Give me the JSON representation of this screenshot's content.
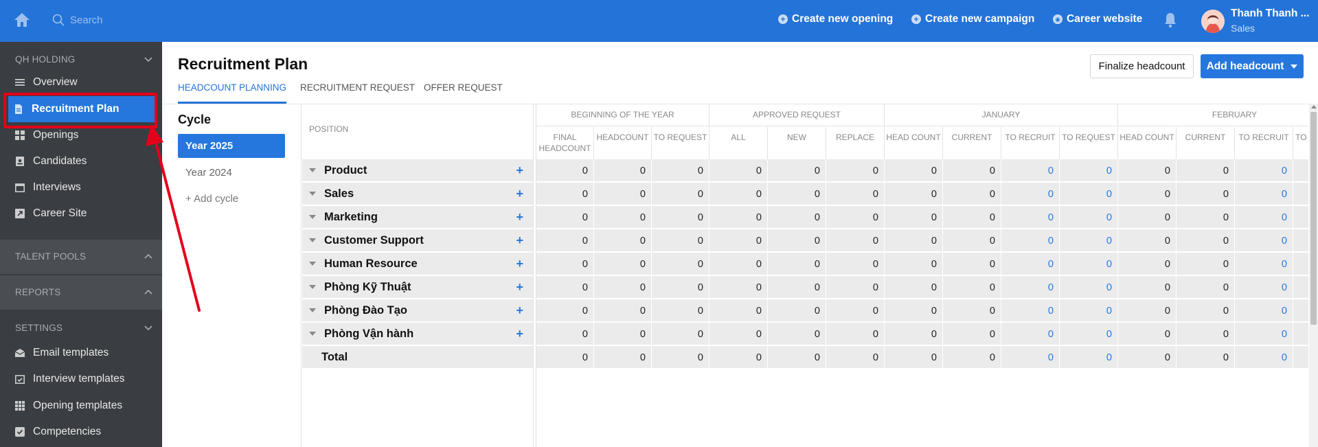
{
  "topbar": {
    "search_placeholder": "Search",
    "links": [
      {
        "label": "Create new opening",
        "icon": "plus-circle-icon"
      },
      {
        "label": "Create new campaign",
        "icon": "plus-circle-icon"
      },
      {
        "label": "Career website",
        "icon": "globe-icon"
      }
    ],
    "user_name": "Thanh Thanh ...",
    "user_role": "Sales",
    "brand_color": "#2473d8"
  },
  "sidebar": {
    "org_name": "QH HOLDING",
    "items": [
      {
        "label": "Overview",
        "icon": "list-icon"
      },
      {
        "label": "Recruitment Plan",
        "icon": "document-icon",
        "active": true
      },
      {
        "label": "Openings",
        "icon": "grid-icon"
      },
      {
        "label": "Candidates",
        "icon": "contact-card-icon"
      },
      {
        "label": "Interviews",
        "icon": "calendar-icon"
      },
      {
        "label": "Career Site",
        "icon": "external-link-icon"
      }
    ],
    "talent_pools": "TALENT POOLS",
    "reports": "REPORTS",
    "settings": "SETTINGS",
    "settings_items": [
      {
        "label": "Email templates",
        "icon": "envelope-icon"
      },
      {
        "label": "Interview templates",
        "icon": "calendar-check-icon"
      },
      {
        "label": "Opening templates",
        "icon": "grid-icon"
      },
      {
        "label": "Competencies",
        "icon": "checkbox-icon"
      }
    ]
  },
  "page": {
    "title": "Recruitment Plan",
    "finalize_label": "Finalize headcount",
    "add_label": "Add headcount",
    "tabs": [
      "HEADCOUNT PLANNING",
      "RECRUITMENT REQUEST",
      "OFFER REQUEST"
    ]
  },
  "cycle": {
    "title": "Cycle",
    "items": [
      "Year 2025",
      "Year 2024"
    ],
    "add_label": "+ Add cycle"
  },
  "table": {
    "position_header": "POSITION",
    "groups": [
      "BEGINNING OF THE YEAR",
      "APPROVED REQUEST",
      "JANUARY",
      "FEBRUARY"
    ],
    "sub_headers": [
      [
        "FINAL",
        "HEADCOUNT"
      ],
      [
        "HEADCOUNT"
      ],
      [
        "TO REQUEST"
      ],
      [
        "ALL"
      ],
      [
        "NEW"
      ],
      [
        "REPLACE"
      ],
      [
        "HEAD COUNT"
      ],
      [
        "CURRENT"
      ],
      [
        "TO RECRUIT"
      ],
      [
        "TO REQUEST"
      ],
      [
        "HEAD COUNT"
      ],
      [
        "CURRENT"
      ],
      [
        "TO RECRUIT"
      ],
      [
        "TO REQUEST"
      ]
    ],
    "rows": [
      {
        "name": "Product",
        "values": [
          "0",
          "0",
          "0",
          "0",
          "0",
          "0",
          "0",
          "0",
          "0",
          "0",
          "0",
          "0",
          "0"
        ]
      },
      {
        "name": "Sales",
        "values": [
          "0",
          "0",
          "0",
          "0",
          "0",
          "0",
          "0",
          "0",
          "0",
          "0",
          "0",
          "0",
          "0"
        ]
      },
      {
        "name": "Marketing",
        "values": [
          "0",
          "0",
          "0",
          "0",
          "0",
          "0",
          "0",
          "0",
          "0",
          "0",
          "0",
          "0",
          "0"
        ]
      },
      {
        "name": "Customer Support",
        "values": [
          "0",
          "0",
          "0",
          "0",
          "0",
          "0",
          "0",
          "0",
          "0",
          "0",
          "0",
          "0",
          "0"
        ]
      },
      {
        "name": "Human Resource",
        "values": [
          "0",
          "0",
          "0",
          "0",
          "0",
          "0",
          "0",
          "0",
          "0",
          "0",
          "0",
          "0",
          "0"
        ]
      },
      {
        "name": "Phòng Kỹ Thuật",
        "values": [
          "0",
          "0",
          "0",
          "0",
          "0",
          "0",
          "0",
          "0",
          "0",
          "0",
          "0",
          "0",
          "0"
        ]
      },
      {
        "name": "Phòng Đào Tạo",
        "values": [
          "0",
          "0",
          "0",
          "0",
          "0",
          "0",
          "0",
          "0",
          "0",
          "0",
          "0",
          "0",
          "0"
        ]
      },
      {
        "name": "Phòng Vận hành",
        "values": [
          "0",
          "0",
          "0",
          "0",
          "0",
          "0",
          "0",
          "0",
          "0",
          "0",
          "0",
          "0",
          "0"
        ]
      }
    ],
    "total": {
      "name": "Total",
      "values": [
        "0",
        "0",
        "0",
        "0",
        "0",
        "0",
        "0",
        "0",
        "0",
        "0",
        "0",
        "0",
        "0"
      ]
    }
  }
}
